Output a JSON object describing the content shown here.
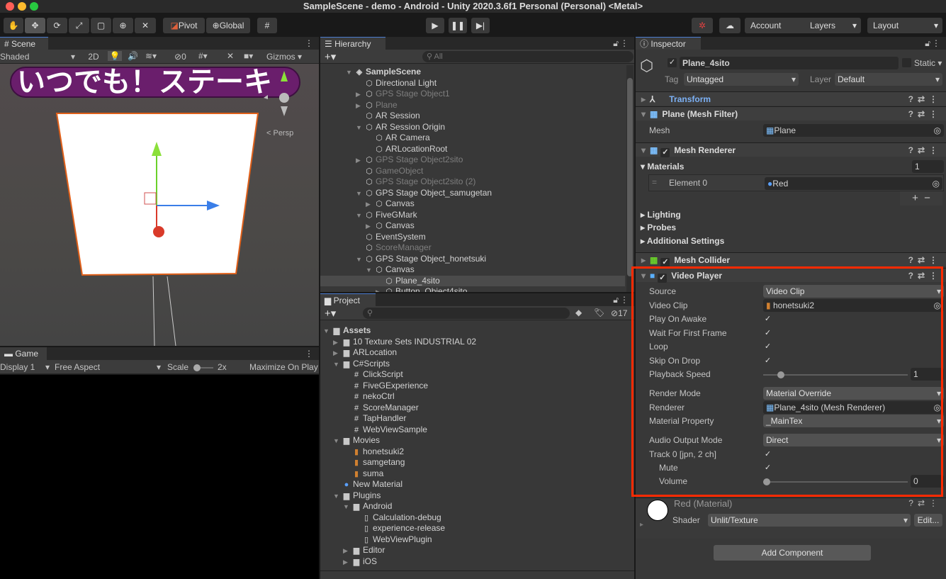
{
  "window": {
    "title": "SampleScene - demo - Android - Unity 2020.3.6f1 Personal (Personal) <Metal>"
  },
  "toolbar": {
    "pivot": "Pivot",
    "global": "Global",
    "account": "Account",
    "layers": "Layers",
    "layout": "Layout"
  },
  "scene": {
    "tab": "Scene",
    "shading": "Shaded",
    "mode_2d": "2D",
    "hidden_count": "0",
    "gizmos": "Gizmos",
    "persp": "< Persp",
    "banner": "いつでも！ステーキ"
  },
  "game": {
    "tab": "Game",
    "display": "Display 1",
    "aspect": "Free Aspect",
    "scale_label": "Scale",
    "scale_value": "2x",
    "maximize": "Maximize On Play"
  },
  "hierarchy": {
    "tab": "Hierarchy",
    "search_placeholder": "All",
    "items": [
      {
        "label": "SampleScene",
        "depth": 0,
        "arrow": "open",
        "kind": "scene"
      },
      {
        "label": "Directional Light",
        "depth": 1
      },
      {
        "label": "GPS Stage Object1",
        "depth": 1,
        "arrow": "closed",
        "grey": true
      },
      {
        "label": "Plane",
        "depth": 1,
        "arrow": "closed",
        "grey": true
      },
      {
        "label": "AR Session",
        "depth": 1
      },
      {
        "label": "AR Session Origin",
        "depth": 1,
        "arrow": "open"
      },
      {
        "label": "AR Camera",
        "depth": 2
      },
      {
        "label": "ARLocationRoot",
        "depth": 2
      },
      {
        "label": "GPS Stage Object2sito",
        "depth": 1,
        "arrow": "closed",
        "grey": true
      },
      {
        "label": "GameObject",
        "depth": 1,
        "grey": true
      },
      {
        "label": "GPS Stage Object2sito (2)",
        "depth": 1,
        "grey": true
      },
      {
        "label": "GPS Stage Object_samugetan",
        "depth": 1,
        "arrow": "open"
      },
      {
        "label": "Canvas",
        "depth": 2,
        "arrow": "closed"
      },
      {
        "label": "FiveGMark",
        "depth": 1,
        "arrow": "open"
      },
      {
        "label": "Canvas",
        "depth": 2,
        "arrow": "closed"
      },
      {
        "label": "EventSystem",
        "depth": 1
      },
      {
        "label": "ScoreManager",
        "depth": 1,
        "grey": true
      },
      {
        "label": "GPS Stage Object_honetsuki",
        "depth": 1,
        "arrow": "open"
      },
      {
        "label": "Canvas",
        "depth": 2,
        "arrow": "open"
      },
      {
        "label": "Plane_4sito",
        "depth": 3,
        "selected": true
      },
      {
        "label": "Button_Object4sito",
        "depth": 3,
        "arrow": "closed"
      }
    ]
  },
  "project": {
    "tab": "Project",
    "hidden_count": "17",
    "items": [
      {
        "label": "Assets",
        "depth": 0,
        "arrow": "open",
        "kind": "folder-open",
        "bold": true
      },
      {
        "label": "10 Texture Sets INDUSTRIAL 02",
        "depth": 1,
        "arrow": "closed",
        "kind": "folder"
      },
      {
        "label": "ARLocation",
        "depth": 1,
        "arrow": "closed",
        "kind": "folder"
      },
      {
        "label": "C#Scripts",
        "depth": 1,
        "arrow": "open",
        "kind": "folder-open"
      },
      {
        "label": "ClickScript",
        "depth": 2,
        "kind": "script"
      },
      {
        "label": "FiveGExperience",
        "depth": 2,
        "kind": "script"
      },
      {
        "label": "nekoCtrl",
        "depth": 2,
        "kind": "script"
      },
      {
        "label": "ScoreManager",
        "depth": 2,
        "kind": "script"
      },
      {
        "label": "TapHandler",
        "depth": 2,
        "kind": "script"
      },
      {
        "label": "WebViewSample",
        "depth": 2,
        "kind": "script"
      },
      {
        "label": "Movies",
        "depth": 1,
        "arrow": "open",
        "kind": "folder-open"
      },
      {
        "label": "honetsuki2",
        "depth": 2,
        "kind": "video"
      },
      {
        "label": "samgetang",
        "depth": 2,
        "kind": "video"
      },
      {
        "label": "suma",
        "depth": 2,
        "kind": "video"
      },
      {
        "label": "New Material",
        "depth": 1,
        "kind": "material"
      },
      {
        "label": "Plugins",
        "depth": 1,
        "arrow": "open",
        "kind": "folder-open"
      },
      {
        "label": "Android",
        "depth": 2,
        "arrow": "open",
        "kind": "folder-open"
      },
      {
        "label": "Calculation-debug",
        "depth": 3,
        "kind": "file"
      },
      {
        "label": "experience-release",
        "depth": 3,
        "kind": "file"
      },
      {
        "label": "WebViewPlugin",
        "depth": 3,
        "kind": "file"
      },
      {
        "label": "Editor",
        "depth": 2,
        "arrow": "closed",
        "kind": "folder"
      },
      {
        "label": "iOS",
        "depth": 2,
        "arrow": "closed",
        "kind": "folder"
      }
    ]
  },
  "inspector": {
    "tab": "Inspector",
    "object_name": "Plane_4sito",
    "static": "Static",
    "tag_label": "Tag",
    "tag": "Untagged",
    "layer_label": "Layer",
    "layer": "Default",
    "transform": "Transform",
    "mesh_filter": "Plane (Mesh Filter)",
    "mesh_label": "Mesh",
    "mesh": "Plane",
    "mesh_renderer": "Mesh Renderer",
    "materials": "Materials",
    "materials_count": "1",
    "element0": "Element 0",
    "element0_value": "Red",
    "lighting": "Lighting",
    "probes": "Probes",
    "additional": "Additional Settings",
    "mesh_collider": "Mesh Collider",
    "video_player": "Video Player",
    "vp": {
      "source_l": "Source",
      "source": "Video Clip",
      "clip_l": "Video Clip",
      "clip": "honetsuki2",
      "play_l": "Play On Awake",
      "wait_l": "Wait For First Frame",
      "loop_l": "Loop",
      "skip_l": "Skip On Drop",
      "speed_l": "Playback Speed",
      "speed": "1",
      "render_mode_l": "Render Mode",
      "render_mode": "Material Override",
      "renderer_l": "Renderer",
      "renderer": "Plane_4sito (Mesh Renderer)",
      "matprop_l": "Material Property",
      "matprop": "_MainTex",
      "audio_l": "Audio Output Mode",
      "audio": "Direct",
      "track_l": "Track 0 [jpn, 2 ch]",
      "mute_l": "Mute",
      "volume_l": "Volume",
      "volume": "0"
    },
    "material_name": "Red (Material)",
    "shader_label": "Shader",
    "shader": "Unlit/Texture",
    "edit": "Edit...",
    "add_component": "Add Component"
  },
  "colors": {
    "highlight": "#ff2a00",
    "transform_link": "#7cb1f5"
  }
}
